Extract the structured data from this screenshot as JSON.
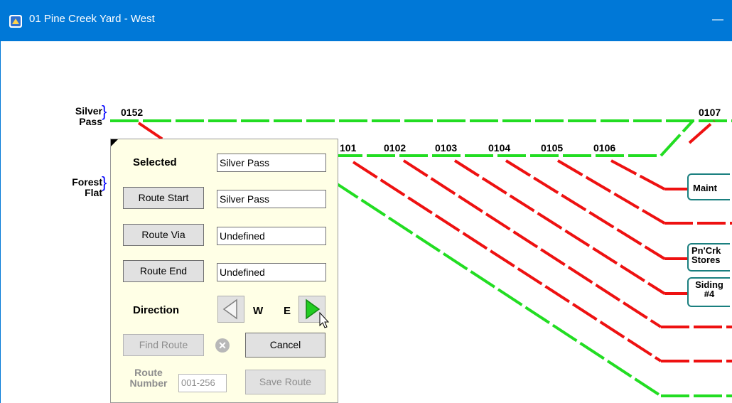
{
  "window": {
    "title": "01 Pine Creek Yard - West",
    "minimize_glyph": "—"
  },
  "yards": {
    "silver_pass": "Silver\nPass",
    "forest_flat": "Forest\nFlat"
  },
  "track_numbers": [
    "0152",
    "101",
    "0102",
    "0103",
    "0104",
    "0105",
    "0106",
    "0107"
  ],
  "destinations": [
    "Maint",
    "Pn'Crk\nStores",
    "Siding\n#4"
  ],
  "colors": {
    "green": "#22dd22",
    "red": "#ee1111",
    "accent": "#0078d7"
  },
  "panel": {
    "selected_label": "Selected",
    "selected_value": "Silver Pass",
    "route_start_btn": "Route Start",
    "route_start_value": "Silver Pass",
    "route_via_btn": "Route Via",
    "route_via_value": "Undefined",
    "route_end_btn": "Route End",
    "route_end_value": "Undefined",
    "direction_label": "Direction",
    "west": "W",
    "east": "E",
    "find_route_btn": "Find Route",
    "cancel_btn": "Cancel",
    "route_number_label": "Route\nNumber",
    "route_number_value": "001-256",
    "save_route_btn": "Save Route",
    "clear_glyph": "✕"
  }
}
